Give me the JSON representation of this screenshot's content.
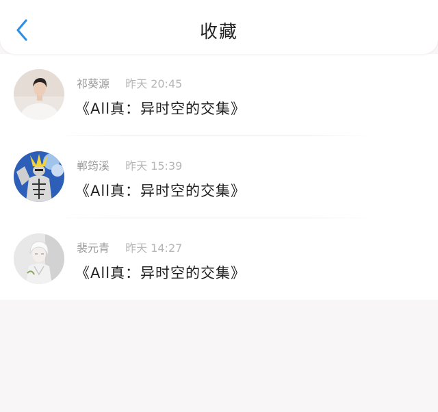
{
  "header": {
    "title": "收藏",
    "back_icon": "chevron-left-icon",
    "accent": "#2f8fe6"
  },
  "favorites": [
    {
      "user": "祁葵源",
      "time": "昨天 20:45",
      "book": "《All真：异时空的交集》",
      "avatar_icon": "person-photo-avatar"
    },
    {
      "user": "郸筠溪",
      "time": "昨天 15:39",
      "book": "《All真：异时空的交集》",
      "avatar_icon": "muscular-hero-avatar"
    },
    {
      "user": "裴元青",
      "time": "昨天 14:27",
      "book": "《All真：异时空的交集》",
      "avatar_icon": "white-hair-avatar"
    }
  ]
}
